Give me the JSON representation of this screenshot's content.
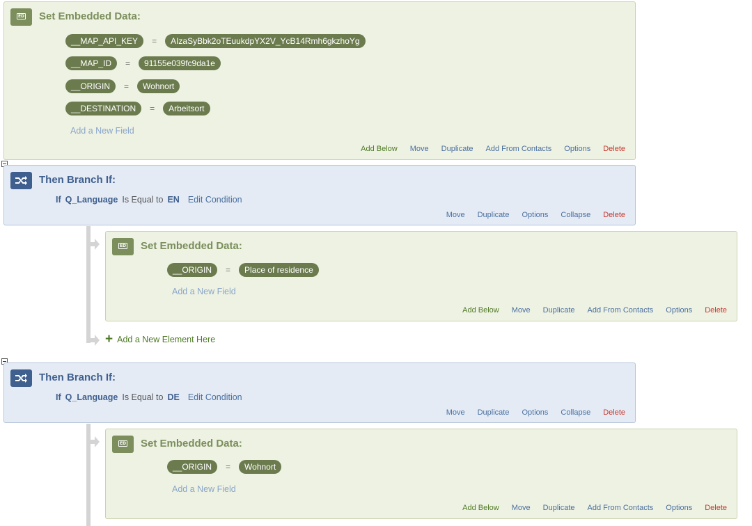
{
  "block1": {
    "title": "Set Embedded Data:",
    "badge": "ED",
    "fields": [
      {
        "name": "__MAP_API_KEY",
        "value": "AIzaSyBbk2oTEuukdpYX2V_YcB14Rmh6gkzhoYg"
      },
      {
        "name": "__MAP_ID",
        "value": "91155e039fc9da1e"
      },
      {
        "name": "__ORIGIN",
        "value": "Wohnort"
      },
      {
        "name": "__DESTINATION",
        "value": "Arbeitsort"
      }
    ],
    "add_field": "Add a New Field",
    "actions": [
      "Add Below",
      "Move",
      "Duplicate",
      "Add From Contacts",
      "Options",
      "Delete"
    ]
  },
  "branch1": {
    "title": "Then Branch If:",
    "if": "If",
    "question": "Q_Language",
    "operator": "Is Equal to",
    "value": "EN",
    "edit": "Edit Condition",
    "actions": [
      "Move",
      "Duplicate",
      "Options",
      "Collapse",
      "Delete"
    ]
  },
  "block2": {
    "title": "Set Embedded Data:",
    "badge": "ED",
    "fields": [
      {
        "name": "__ORIGIN",
        "value": "Place of residence"
      }
    ],
    "add_field": "Add a New Field",
    "actions": [
      "Add Below",
      "Move",
      "Duplicate",
      "Add From Contacts",
      "Options",
      "Delete"
    ]
  },
  "add_element": "Add a New Element Here",
  "branch2": {
    "title": "Then Branch If:",
    "if": "If",
    "question": "Q_Language",
    "operator": "Is Equal to",
    "value": "DE",
    "edit": "Edit Condition",
    "actions": [
      "Move",
      "Duplicate",
      "Options",
      "Collapse",
      "Delete"
    ]
  },
  "block3": {
    "title": "Set Embedded Data:",
    "badge": "ED",
    "fields": [
      {
        "name": "__ORIGIN",
        "value": "Wohnort"
      }
    ],
    "add_field": "Add a New Field",
    "actions": [
      "Add Below",
      "Move",
      "Duplicate",
      "Add From Contacts",
      "Options",
      "Delete"
    ]
  },
  "equals_sign": "=",
  "plus_sign": "+",
  "colors": {
    "ed_accent": "#7b8e5c",
    "branch_accent": "#3f5f8e",
    "pill": "#6b7b4e",
    "delete": "#c43a2f",
    "add_below": "#4f7a26"
  }
}
